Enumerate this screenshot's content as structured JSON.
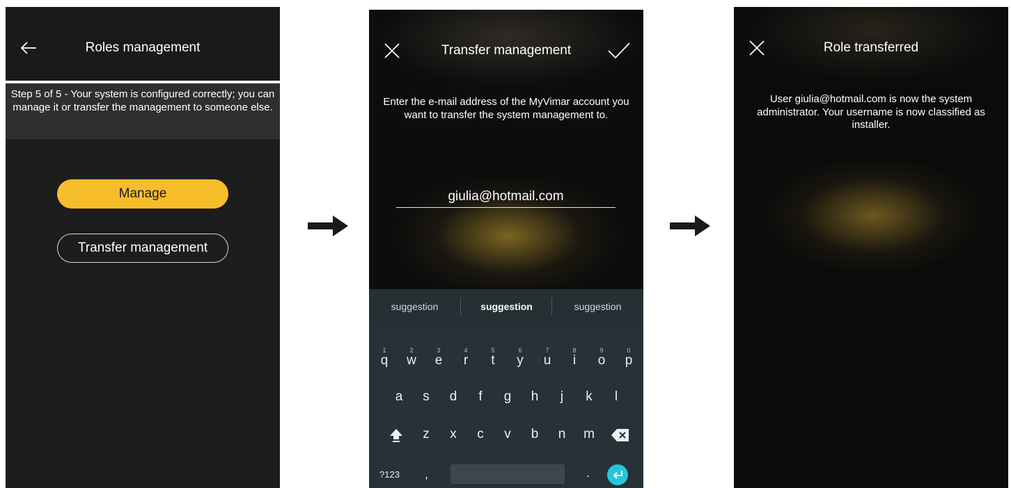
{
  "screen1": {
    "title": "Roles management",
    "back_icon": "arrow-left-icon",
    "step_text": "Step 5 of 5 -  Your system is configured correctly; you can manage it or transfer the management to someone else.",
    "manage_label": "Manage",
    "transfer_label": "Transfer management",
    "accent_color": "#f7bd2b"
  },
  "screen2": {
    "title": "Transfer management",
    "close_icon": "close-icon",
    "confirm_icon": "check-icon",
    "prompt": "Enter the e-mail address of the MyVimar account you want to transfer the system management to.",
    "email_value": "giulia@hotmail.com",
    "keyboard": {
      "suggestions": [
        "suggestion",
        "suggestion",
        "suggestion"
      ],
      "row1": [
        "q",
        "w",
        "e",
        "r",
        "t",
        "y",
        "u",
        "i",
        "o",
        "p"
      ],
      "row1_hints": [
        "1",
        "2",
        "3",
        "4",
        "5",
        "6",
        "7",
        "8",
        "9",
        "0"
      ],
      "row2": [
        "a",
        "s",
        "d",
        "f",
        "g",
        "h",
        "j",
        "k",
        "l"
      ],
      "row3": [
        "z",
        "x",
        "c",
        "v",
        "b",
        "n",
        "m"
      ],
      "symbols_label": "?123",
      "comma_label": ",",
      "period_label": ".",
      "shift_icon": "shift-icon",
      "backspace_icon": "backspace-icon",
      "enter_icon": "enter-icon",
      "enter_color": "#26c6da"
    }
  },
  "screen3": {
    "title": "Role transferred",
    "close_icon": "close-icon",
    "message": "User giulia@hotmail.com is now the system administrator. Your username is now classified as installer."
  },
  "flow_arrow_icon": "arrow-right-icon"
}
